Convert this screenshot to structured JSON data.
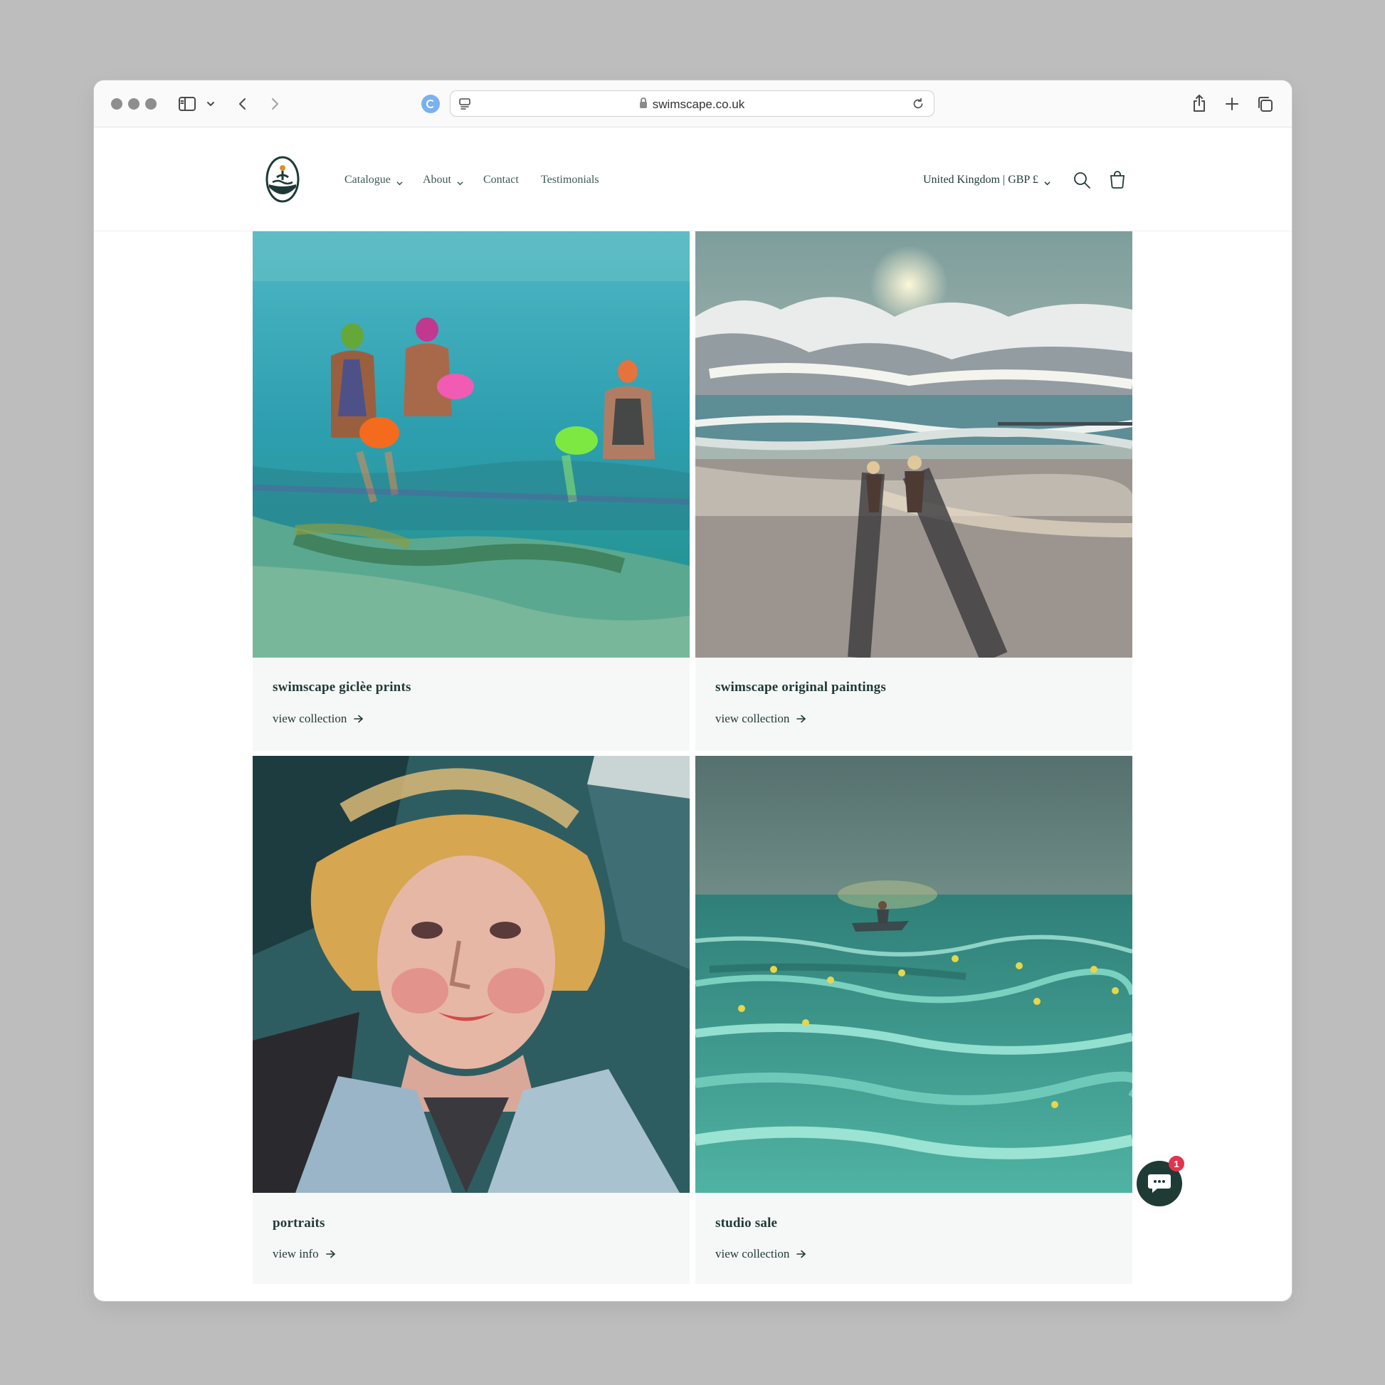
{
  "browser": {
    "url": "swimscape.co.uk"
  },
  "nav": {
    "items": [
      {
        "label": "Catalogue",
        "has_dropdown": true
      },
      {
        "label": "About",
        "has_dropdown": true
      },
      {
        "label": "Contact",
        "has_dropdown": false
      },
      {
        "label": "Testimonials",
        "has_dropdown": false
      }
    ],
    "locale": "United Kingdom | GBP £"
  },
  "collections": [
    {
      "title": "swimscape giclèe prints",
      "link": "view collection"
    },
    {
      "title": "swimscape original paintings",
      "link": "view collection"
    },
    {
      "title": "portraits",
      "link": "view info"
    },
    {
      "title": "studio sale",
      "link": "view collection"
    }
  ],
  "chat": {
    "badge": "1"
  },
  "colors": {
    "brand_text": "#1f3a36",
    "card_bg": "#f6f7f7",
    "chat_button": "#1e3b35",
    "badge": "#e2344f"
  }
}
